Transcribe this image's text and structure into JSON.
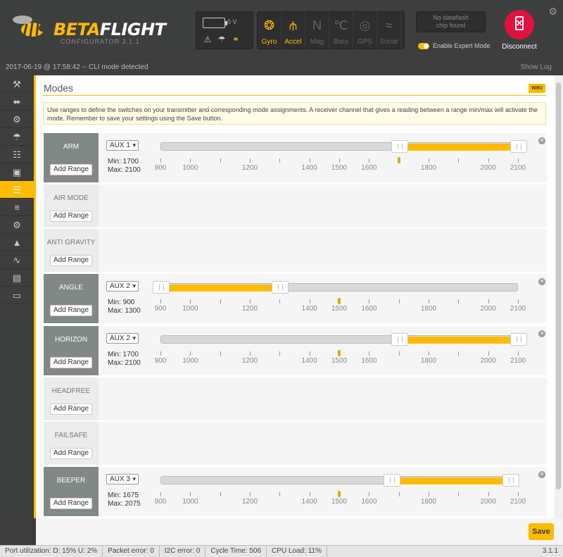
{
  "header": {
    "logo_beta": "BETA",
    "logo_flight": "FLIGHT",
    "logo_sub": "CONFIGURATOR  3.1.1",
    "voltage": "0 V",
    "sensors": [
      {
        "label": "Gyro",
        "icon": "gyro-icon",
        "glyph": "❂",
        "state": "on"
      },
      {
        "label": "Accel",
        "icon": "accel-icon",
        "glyph": "⫛",
        "state": "on"
      },
      {
        "label": "Mag",
        "icon": "mag-icon",
        "glyph": "N",
        "state": "off"
      },
      {
        "label": "Baro",
        "icon": "baro-icon",
        "glyph": "℃",
        "state": "off"
      },
      {
        "label": "GPS",
        "icon": "gps-icon",
        "glyph": "◎",
        "state": "off"
      },
      {
        "label": "Sonar",
        "icon": "sonar-icon",
        "glyph": "≈",
        "state": "off"
      }
    ],
    "dataflash": "No dataflash\nchip found",
    "expert_mode": "Enable Expert Mode",
    "disconnect": "Disconnect"
  },
  "status_top": {
    "log": "2017-06-19 @ 17:58:42 -- CLI mode detected",
    "show_log": "Show Log"
  },
  "sidebar": [
    {
      "name": "nav-setup",
      "glyph": "⚒"
    },
    {
      "name": "nav-ports",
      "glyph": "⬌"
    },
    {
      "name": "nav-configuration",
      "glyph": "⚙"
    },
    {
      "name": "nav-failsafe",
      "glyph": "☂"
    },
    {
      "name": "nav-pid-tuning",
      "glyph": "☷"
    },
    {
      "name": "nav-receiver",
      "glyph": "▣"
    },
    {
      "name": "nav-modes",
      "glyph": "☰",
      "active": true
    },
    {
      "name": "nav-adjustments",
      "glyph": "≡"
    },
    {
      "name": "nav-servos",
      "glyph": "⚙"
    },
    {
      "name": "nav-motors",
      "glyph": "▲"
    },
    {
      "name": "nav-blackbox",
      "glyph": "∿"
    },
    {
      "name": "nav-cli",
      "glyph": "▤"
    },
    {
      "name": "nav-osd",
      "glyph": "▭"
    }
  ],
  "page": {
    "title": "Modes",
    "wiki": "WIKI",
    "note": "Use ranges to define the switches on your transmitter and corresponding mode assignments. A receiver channel that gives a reading between a range min/max will activate the mode. Remember to save your settings using the Save button.",
    "add_range": "Add Range",
    "save": "Save"
  },
  "scale": {
    "min": 900,
    "max": 2100,
    "labels": [
      "900",
      "1000",
      "1200",
      "1400",
      "1500",
      "1600",
      "1800",
      "2000",
      "2100"
    ]
  },
  "modes": [
    {
      "name": "ARM",
      "active": true,
      "aux": "AUX 1",
      "min_text": "Min: 1700",
      "max_text": "Max: 2100",
      "min": 1700,
      "max": 2100,
      "value": 1700
    },
    {
      "name": "AIR MODE",
      "active": false
    },
    {
      "name": "ANTI GRAVITY",
      "active": false
    },
    {
      "name": "ANGLE",
      "active": true,
      "aux": "AUX 2",
      "min_text": "Min: 900",
      "max_text": "Max: 1300",
      "min": 900,
      "max": 1300,
      "value": 1500
    },
    {
      "name": "HORIZON",
      "active": true,
      "aux": "AUX 2",
      "min_text": "Min: 1700",
      "max_text": "Max: 2100",
      "min": 1700,
      "max": 2100,
      "value": 1500
    },
    {
      "name": "HEADFREE",
      "active": false
    },
    {
      "name": "FAILSAFE",
      "active": false
    },
    {
      "name": "BEEPER",
      "active": true,
      "aux": "AUX 3",
      "min_text": "Min: 1675",
      "max_text": "Max: 2075",
      "min": 1675,
      "max": 2075,
      "value": 1500
    }
  ],
  "footer": {
    "port": "Port utilization: D: 15% U: 2%",
    "packet": "Packet error: 0",
    "i2c": "I2C error: 0",
    "cycle": "Cycle Time: 506",
    "cpu": "CPU Load: 11%",
    "version": "3.1.1"
  }
}
